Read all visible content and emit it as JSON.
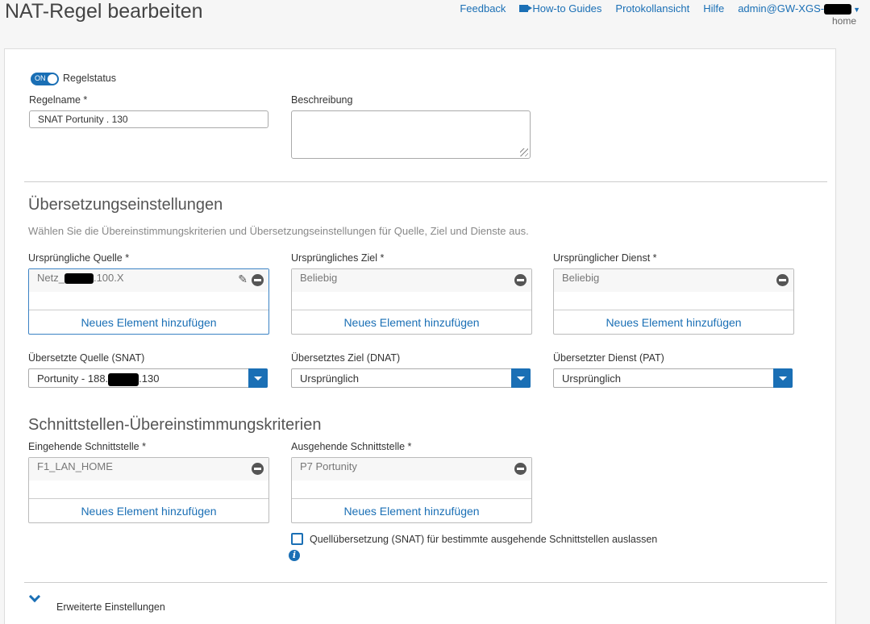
{
  "header": {
    "title": "NAT-Regel bearbeiten",
    "nav": {
      "feedback": "Feedback",
      "guides": "How-to Guides",
      "log": "Protokollansicht",
      "help": "Hilfe",
      "user": "admin@GW-XGS-",
      "user_sub": "home"
    }
  },
  "form": {
    "status_toggle": "ON",
    "status_label": "Regelstatus",
    "rule_name_label": "Regelname *",
    "rule_name_value": "SNAT Portunity . 130",
    "description_label": "Beschreibung",
    "description_value": ""
  },
  "translation": {
    "title": "Übersetzungseinstellungen",
    "desc": "Wählen Sie die Übereinstimmungskriterien und Übersetzungseinstellungen für Quelle, Ziel und Dienste aus.",
    "orig_source_label": "Ursprüngliche Quelle *",
    "orig_source_item_a": "Netz_",
    "orig_source_item_b": ".100.X",
    "orig_dest_label": "Ursprüngliches Ziel *",
    "orig_dest_item": "Beliebig",
    "orig_service_label": "Ursprünglicher Dienst *",
    "orig_service_item": "Beliebig",
    "add_new": "Neues Element hinzufügen",
    "snat_label": "Übersetzte Quelle (SNAT)",
    "snat_value_a": "Portunity - 188.",
    "snat_value_b": ".130",
    "dnat_label": "Übersetztes Ziel (DNAT)",
    "dnat_value": "Ursprünglich",
    "pat_label": "Übersetzter Dienst (PAT)",
    "pat_value": "Ursprünglich"
  },
  "interfaces": {
    "title": "Schnittstellen-Übereinstimmungskriterien",
    "in_label": "Eingehende Schnittstelle *",
    "in_item": "F1_LAN_HOME",
    "out_label": "Ausgehende Schnittstelle *",
    "out_item": "P7 Portunity",
    "skip_snat_label": "Quellübersetzung (SNAT) für bestimmte ausgehende Schnittstellen auslassen"
  },
  "advanced": {
    "label": "Erweiterte Einstellungen"
  },
  "colors": {
    "accent": "#1a6fb5"
  }
}
